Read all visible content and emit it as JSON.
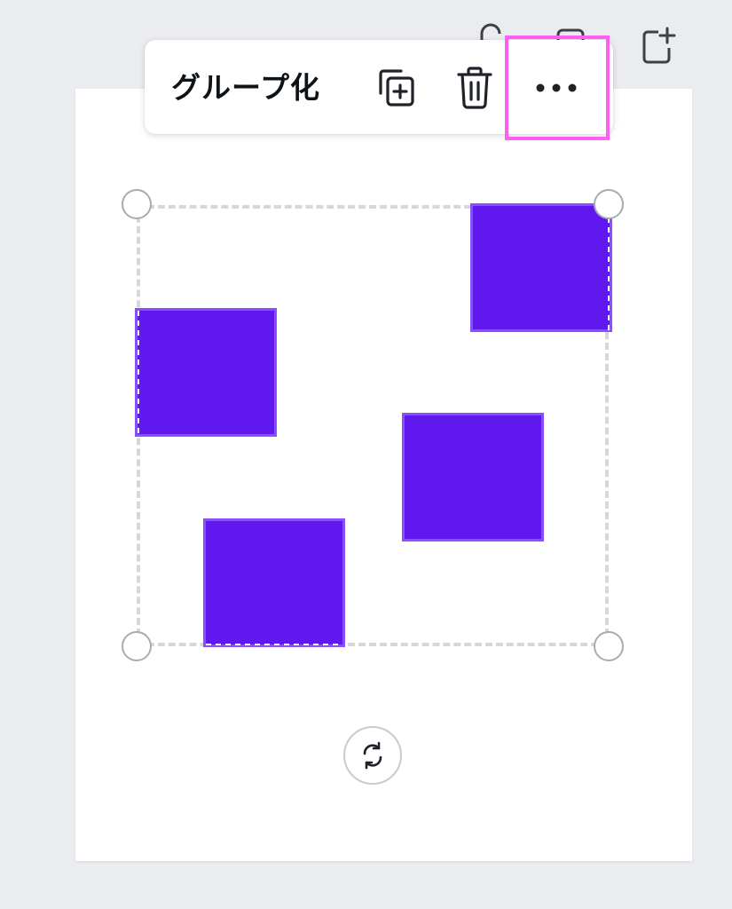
{
  "toolbar": {
    "group_label": "グループ化",
    "duplicate_icon": "duplicate-icon",
    "delete_icon": "trash-icon",
    "more_icon": "more-options-icon"
  },
  "top_icons": [
    "lock-icon",
    "comment-icon",
    "add-page-icon"
  ],
  "selection": {
    "rotate_icon": "rotate-icon"
  },
  "shapes": {
    "count": 4,
    "fill_color": "#5f19ee",
    "border_color": "#8a4dff"
  },
  "highlight_color": "#ff5ff1"
}
